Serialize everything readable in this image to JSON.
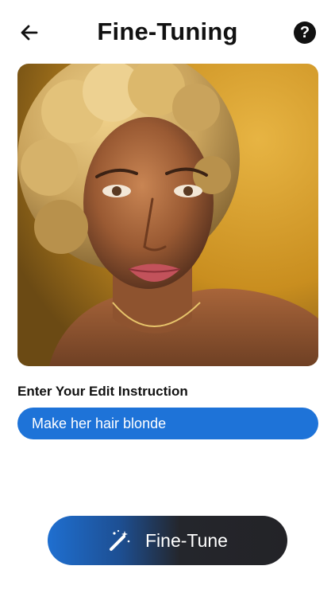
{
  "header": {
    "title": "Fine-Tuning",
    "back_icon": "arrow-left-icon",
    "help_icon": "question-circle-icon",
    "help_glyph": "?"
  },
  "image": {
    "description_icon": "portrait-image"
  },
  "edit": {
    "label": "Enter Your Edit Instruction",
    "value": "Make her hair blonde"
  },
  "cta": {
    "label": "Fine-Tune",
    "icon": "magic-wand-icon"
  },
  "colors": {
    "accent": "#1e73d8",
    "cta_dark": "#232327",
    "text": "#111111"
  }
}
